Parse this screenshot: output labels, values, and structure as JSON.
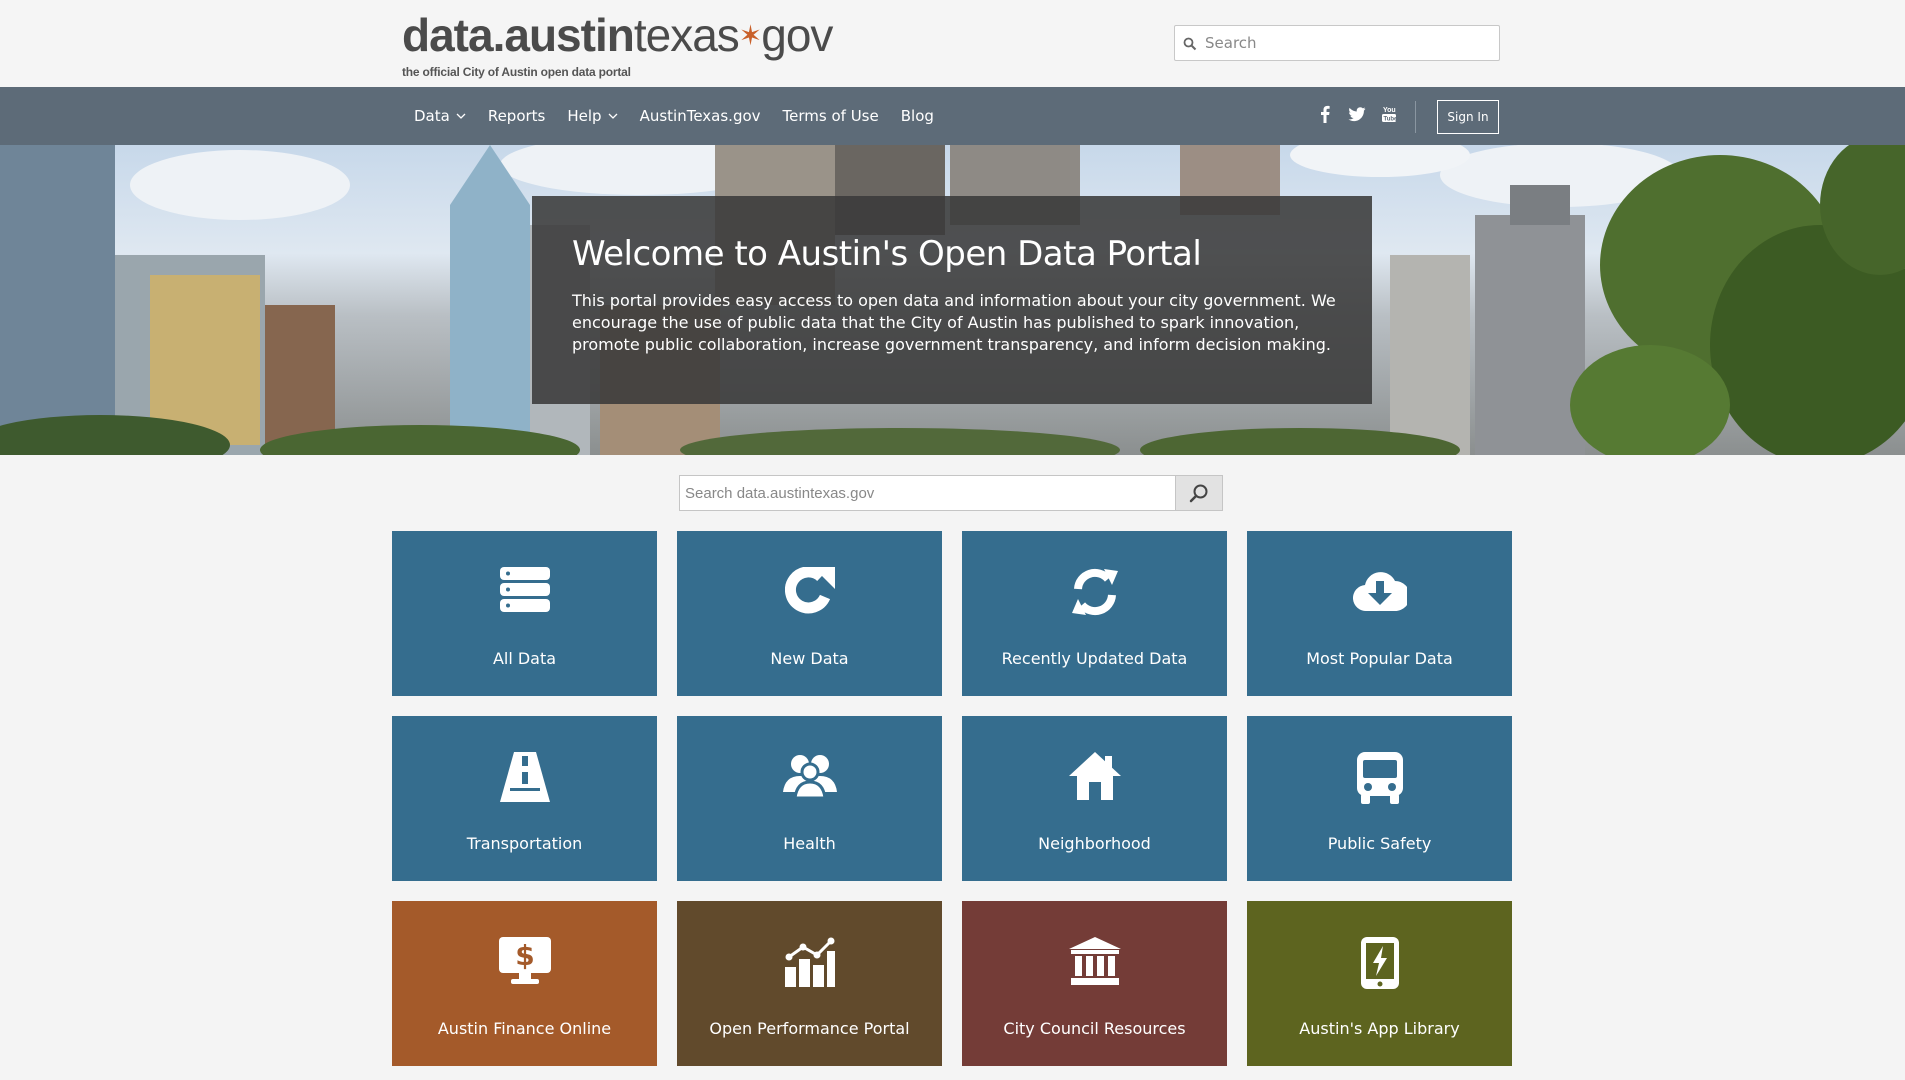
{
  "header": {
    "logo_bold": "data.austin",
    "logo_light": "texas",
    "logo_gov": "gov",
    "logo_tagline": "the official City of Austin open data portal",
    "search_placeholder": "Search"
  },
  "nav": {
    "items": [
      {
        "label": "Data",
        "dropdown": true
      },
      {
        "label": "Reports",
        "dropdown": false
      },
      {
        "label": "Help",
        "dropdown": true
      },
      {
        "label": "AustinTexas.gov",
        "dropdown": false
      },
      {
        "label": "Terms of Use",
        "dropdown": false
      },
      {
        "label": "Blog",
        "dropdown": false
      }
    ],
    "social": [
      "facebook-icon",
      "twitter-icon",
      "youtube-icon"
    ],
    "signin_label": "Sign In"
  },
  "hero": {
    "title": "Welcome to Austin's Open Data Portal",
    "text": "This portal provides easy access to open data and information about your city government. We encourage the use of public data that the City of Austin has published to spark innovation, promote public collaboration, increase government transparency, and inform decision making."
  },
  "main_search": {
    "placeholder": "Search data.austintexas.gov"
  },
  "tiles": [
    {
      "label": "All Data",
      "icon": "database-icon",
      "color": "#356d8e"
    },
    {
      "label": "New Data",
      "icon": "refresh-arrow-icon",
      "color": "#356d8e"
    },
    {
      "label": "Recently Updated Data",
      "icon": "sync-icon",
      "color": "#356d8e"
    },
    {
      "label": "Most Popular Data",
      "icon": "cloud-download-icon",
      "color": "#356d8e"
    },
    {
      "label": "Transportation",
      "icon": "road-icon",
      "color": "#356d8e"
    },
    {
      "label": "Health",
      "icon": "people-icon",
      "color": "#356d8e"
    },
    {
      "label": "Neighborhood",
      "icon": "house-icon",
      "color": "#356d8e"
    },
    {
      "label": "Public Safety",
      "icon": "bus-icon",
      "color": "#356d8e"
    },
    {
      "label": "Austin Finance Online",
      "icon": "monitor-dollar-icon",
      "color": "#a45a2a"
    },
    {
      "label": "Open Performance Portal",
      "icon": "bar-chart-icon",
      "color": "#614a2c"
    },
    {
      "label": "City Council Resources",
      "icon": "government-building-icon",
      "color": "#743c37"
    },
    {
      "label": "Austin's App Library",
      "icon": "mobile-app-icon",
      "color": "#5d641f"
    }
  ]
}
